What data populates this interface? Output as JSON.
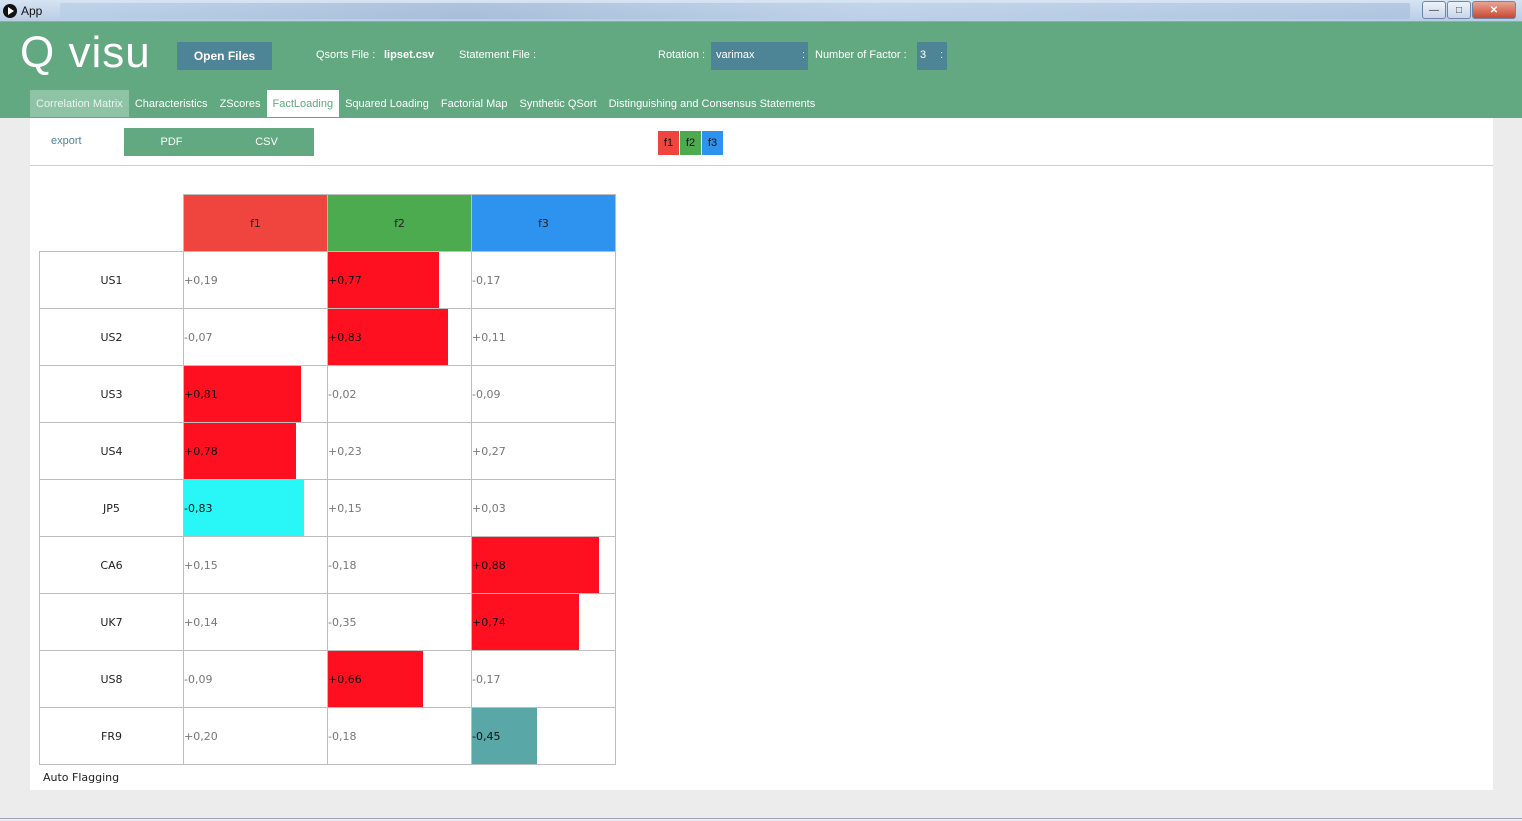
{
  "window": {
    "title": "App"
  },
  "header": {
    "logo": "Q visu",
    "open_files": "Open Files",
    "qsorts_label": "Qsorts File :",
    "qsorts_value": "lipset.csv",
    "statement_label": "Statement File :",
    "rotation_label": "Rotation :",
    "rotation_value": "varimax",
    "factor_count_label": "Number of Factor :",
    "factor_count_value": "3",
    "dropdown_glyph": ":"
  },
  "tabs": [
    {
      "label": "Correlation Matrix"
    },
    {
      "label": "Characteristics"
    },
    {
      "label": "ZScores"
    },
    {
      "label": "FactLoading"
    },
    {
      "label": "Squared Loading"
    },
    {
      "label": "Factorial Map"
    },
    {
      "label": "Synthetic QSort"
    },
    {
      "label": "Distinguishing and Consensus Statements"
    }
  ],
  "toolbar": {
    "export_label": "export",
    "pdf_label": "PDF",
    "csv_label": "CSV",
    "factor_chips": [
      {
        "label": "f1",
        "color": "#f0453f"
      },
      {
        "label": "f2",
        "color": "#4caa4f"
      },
      {
        "label": "f3",
        "color": "#2e93ee"
      }
    ]
  },
  "loadings": {
    "factors": [
      {
        "name": "f1",
        "color": "#f0453f"
      },
      {
        "name": "f2",
        "color": "#4caa4f"
      },
      {
        "name": "f3",
        "color": "#2e93ee"
      }
    ],
    "colors": {
      "positive_flag": "#ff1020",
      "negative_flag": "#29f7f7",
      "negative_flag_f3": "#5aa7a7"
    },
    "rows": [
      {
        "label": "US1",
        "values": [
          {
            "text": "+0,19",
            "value": 0.19
          },
          {
            "text": "+0,77",
            "value": 0.77,
            "flag": "#ff1020"
          },
          {
            "text": "-0,17",
            "value": -0.17
          }
        ]
      },
      {
        "label": "US2",
        "values": [
          {
            "text": "-0,07",
            "value": -0.07
          },
          {
            "text": "+0,83",
            "value": 0.83,
            "flag": "#ff1020"
          },
          {
            "text": "+0,11",
            "value": 0.11
          }
        ]
      },
      {
        "label": "US3",
        "values": [
          {
            "text": "+0,81",
            "value": 0.81,
            "flag": "#ff1020"
          },
          {
            "text": "-0,02",
            "value": -0.02
          },
          {
            "text": "-0,09",
            "value": -0.09
          }
        ]
      },
      {
        "label": "US4",
        "values": [
          {
            "text": "+0,78",
            "value": 0.78,
            "flag": "#ff1020"
          },
          {
            "text": "+0,23",
            "value": 0.23
          },
          {
            "text": "+0,27",
            "value": 0.27
          }
        ]
      },
      {
        "label": "JP5",
        "values": [
          {
            "text": "-0,83",
            "value": -0.83,
            "flag": "#29f7f7"
          },
          {
            "text": "+0,15",
            "value": 0.15
          },
          {
            "text": "+0,03",
            "value": 0.03
          }
        ]
      },
      {
        "label": "CA6",
        "values": [
          {
            "text": "+0,15",
            "value": 0.15
          },
          {
            "text": "-0,18",
            "value": -0.18
          },
          {
            "text": "+0,88",
            "value": 0.88,
            "flag": "#ff1020"
          }
        ]
      },
      {
        "label": "UK7",
        "values": [
          {
            "text": "+0,14",
            "value": 0.14
          },
          {
            "text": "-0,35",
            "value": -0.35
          },
          {
            "text": "+0,74",
            "value": 0.74,
            "flag": "#ff1020"
          }
        ]
      },
      {
        "label": "US8",
        "values": [
          {
            "text": "-0,09",
            "value": -0.09
          },
          {
            "text": "+0,66",
            "value": 0.66,
            "flag": "#ff1020"
          },
          {
            "text": "-0,17",
            "value": -0.17
          }
        ]
      },
      {
        "label": "FR9",
        "values": [
          {
            "text": "+0,20",
            "value": 0.2
          },
          {
            "text": "-0,18",
            "value": -0.18
          },
          {
            "text": "-0,45",
            "value": -0.45,
            "flag": "#5aa7a7"
          }
        ]
      }
    ],
    "auto_flagging_label": "Auto Flagging"
  }
}
